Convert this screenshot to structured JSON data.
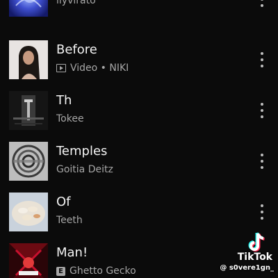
{
  "tracks": [
    {
      "title": "",
      "subtitle": "ilyvirato",
      "badge": "",
      "icon": "more-vert-icon"
    },
    {
      "title": "Before",
      "subtitle": "Video • NIKI",
      "badge": "video",
      "icon": "more-vert-icon"
    },
    {
      "title": "Th",
      "subtitle": "Tokee",
      "badge": "",
      "icon": "more-vert-icon"
    },
    {
      "title": "Temples",
      "subtitle": "Goitia Deitz",
      "badge": "",
      "icon": "more-vert-icon"
    },
    {
      "title": "Of",
      "subtitle": "Teeth",
      "badge": "",
      "icon": "more-vert-icon"
    },
    {
      "title": "Man!",
      "subtitle": "Ghetto Gecko",
      "badge": "explicit",
      "icon": "more-vert-icon"
    }
  ],
  "badges": {
    "explicit_label": "E"
  },
  "watermark": {
    "brand": "TikTok",
    "username": "@ s0vere1gn_"
  },
  "colors": {
    "background": "#0b0b0b",
    "title": "#f4f4f4",
    "subtitle": "#a7a7a7",
    "accent_cyan": "#25f4ee",
    "accent_pink": "#fe2c55"
  }
}
